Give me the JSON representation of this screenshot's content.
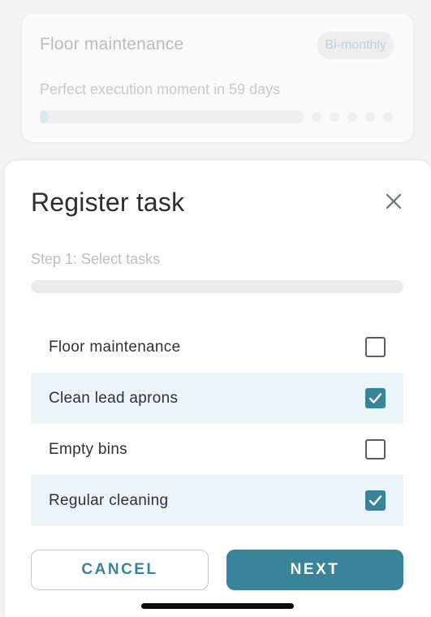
{
  "background_card": {
    "title": "Floor maintenance",
    "badge": "Bi-monthly",
    "subtitle": "Perfect execution moment in 59 days",
    "progress_fraction": 0.03
  },
  "sheet": {
    "title": "Register task",
    "close_icon": "close-icon",
    "step_label": "Step 1: Select tasks",
    "step_progress_fraction": 0.0
  },
  "tasks": [
    {
      "label": "Floor maintenance",
      "checked": false
    },
    {
      "label": "Clean lead aprons",
      "checked": true
    },
    {
      "label": "Empty bins",
      "checked": false
    },
    {
      "label": "Regular cleaning",
      "checked": true
    }
  ],
  "buttons": {
    "cancel_label": "CANCEL",
    "next_label": "NEXT"
  },
  "colors": {
    "accent": "#3a8499",
    "checked_row_bg": "#ebf4f7"
  }
}
